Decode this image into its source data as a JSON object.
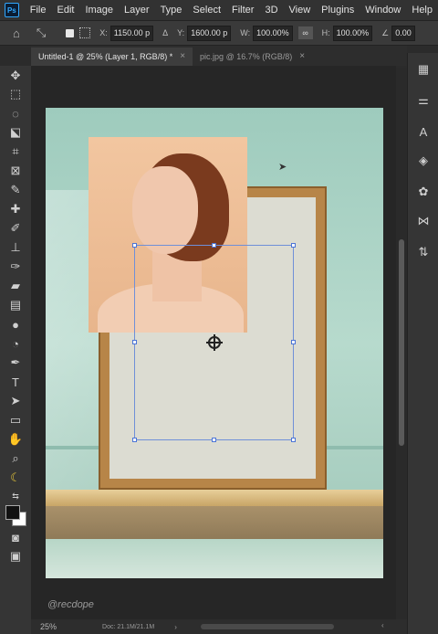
{
  "app": {
    "logo_text": "Ps"
  },
  "menu": [
    "File",
    "Edit",
    "Image",
    "Layer",
    "Type",
    "Select",
    "Filter",
    "3D",
    "View",
    "Plugins",
    "Window",
    "Help"
  ],
  "options": {
    "x_label": "X:",
    "x_value": "1150.00 p",
    "y_label": "Y:",
    "y_value": "1600.00 p",
    "w_label": "W:",
    "w_value": "100.00%",
    "h_label": "H:",
    "h_value": "100.00%",
    "angle_value": "0.00"
  },
  "tabs": [
    {
      "label": "Untitled-1 @ 25% (Layer 1, RGB/8) *",
      "active": true
    },
    {
      "label": "pic.jpg @ 16.7% (RGB/8)",
      "active": false
    }
  ],
  "canvas": {
    "watermark": "@recdope"
  },
  "status": {
    "zoom": "25%",
    "doc": "Doc: 21.1M/21.1M"
  },
  "icons": {
    "home": "home-icon",
    "move": "move-icon",
    "marquee": "rectangular-marquee-icon",
    "lasso": "lasso-icon",
    "crop": "crop-icon",
    "brush": "brush-icon",
    "type": "type-icon",
    "hand": "hand-icon",
    "zoom": "zoom-icon"
  }
}
